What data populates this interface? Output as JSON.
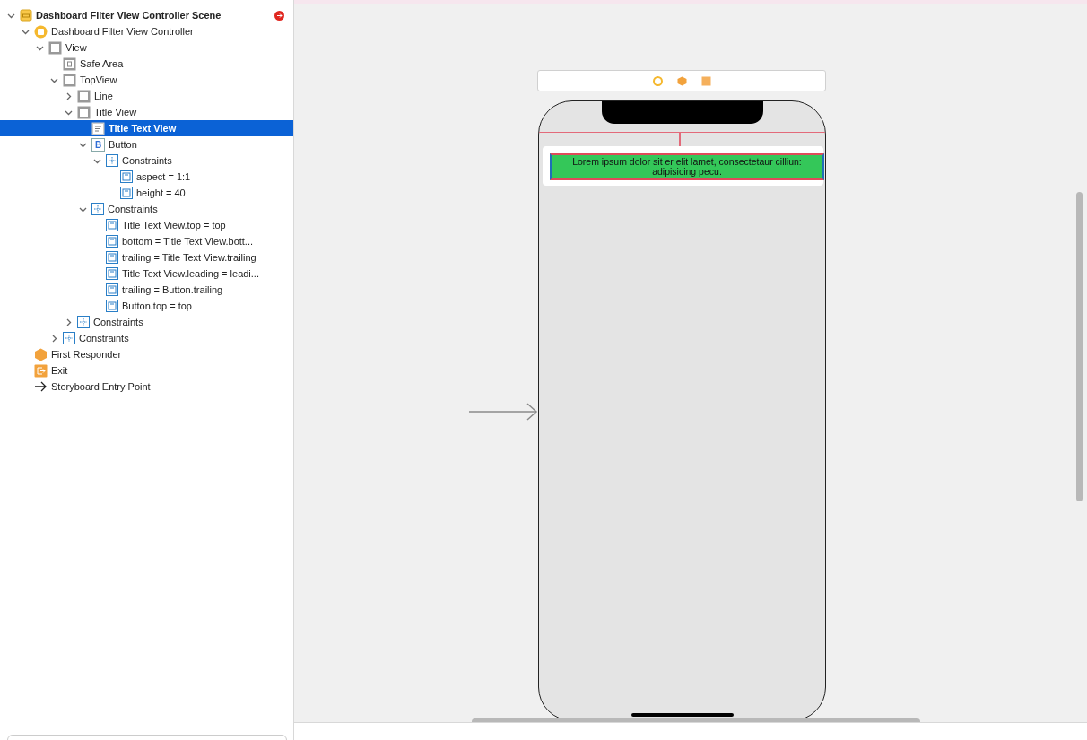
{
  "outline": {
    "items": [
      {
        "label": "Dashboard Filter View Controller Scene",
        "kind": "scene",
        "expanded": true,
        "selected": false,
        "children": [
          {
            "label": "Dashboard Filter View Controller",
            "kind": "controller",
            "expanded": true,
            "selected": false,
            "children": [
              {
                "label": "View",
                "kind": "view",
                "expanded": true,
                "selected": false,
                "children": [
                  {
                    "label": "Safe Area",
                    "kind": "safearea",
                    "selected": false
                  },
                  {
                    "label": "TopView",
                    "kind": "view",
                    "expanded": true,
                    "selected": false,
                    "children": [
                      {
                        "label": "Line",
                        "kind": "view",
                        "expanded": false,
                        "selected": false
                      },
                      {
                        "label": "Title View",
                        "kind": "view",
                        "expanded": true,
                        "selected": false,
                        "children": [
                          {
                            "label": "Title Text View",
                            "kind": "textview",
                            "selected": true
                          },
                          {
                            "label": "Button",
                            "kind": "button",
                            "glyph": "B",
                            "expanded": true,
                            "selected": false,
                            "children": [
                              {
                                "label": "Constraints",
                                "kind": "constraints",
                                "expanded": true,
                                "selected": false,
                                "children": [
                                  {
                                    "label": "aspect = 1:1",
                                    "kind": "constraint",
                                    "selected": false
                                  },
                                  {
                                    "label": "height = 40",
                                    "kind": "constraint",
                                    "selected": false
                                  }
                                ]
                              }
                            ]
                          },
                          {
                            "label": "Constraints",
                            "kind": "constraints",
                            "expanded": true,
                            "selected": false,
                            "children": [
                              {
                                "label": "Title Text View.top = top",
                                "kind": "constraint",
                                "selected": false
                              },
                              {
                                "label": "bottom = Title Text View.bott...",
                                "kind": "constraint",
                                "selected": false
                              },
                              {
                                "label": "trailing = Title Text View.trailing",
                                "kind": "constraint",
                                "selected": false
                              },
                              {
                                "label": "Title Text View.leading = leadi...",
                                "kind": "constraint",
                                "selected": false
                              },
                              {
                                "label": "trailing = Button.trailing",
                                "kind": "constraint",
                                "selected": false
                              },
                              {
                                "label": "Button.top = top",
                                "kind": "constraint",
                                "selected": false
                              }
                            ]
                          }
                        ]
                      },
                      {
                        "label": "Constraints",
                        "kind": "constraints",
                        "expanded": false,
                        "selected": false
                      }
                    ]
                  },
                  {
                    "label": "Constraints",
                    "kind": "constraints",
                    "expanded": false,
                    "selected": false
                  }
                ]
              }
            ]
          },
          {
            "label": "First Responder",
            "kind": "responder",
            "selected": false
          },
          {
            "label": "Exit",
            "kind": "exit",
            "selected": false
          },
          {
            "label": "Storyboard Entry Point",
            "kind": "entry",
            "selected": false
          }
        ]
      }
    ]
  },
  "canvas": {
    "title_text": "Lorem ipsum dolor sit er elit lamet, consectetaur cilliun: adipisicing pecu."
  }
}
